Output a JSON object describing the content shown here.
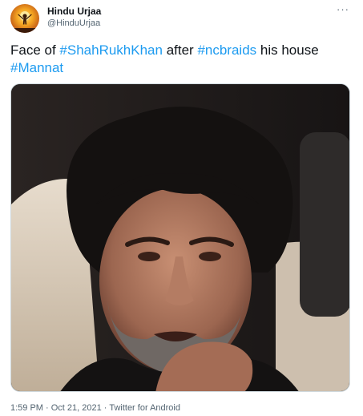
{
  "author": {
    "display_name": "Hindu Urjaa",
    "handle": "@HinduUrjaa"
  },
  "more_icon": "···",
  "tweet_text": {
    "t1": "Face of ",
    "h1": "#ShahRukhKhan",
    "t2": " after ",
    "h2": "#ncbraids",
    "t3": " his house ",
    "h3": "#Mannat"
  },
  "meta": {
    "time": "1:59 PM",
    "sep1": " · ",
    "date": "Oct 21, 2021",
    "sep2": " · ",
    "source": "Twitter for Android"
  },
  "colors": {
    "link": "#1d9bf0",
    "secondary_text": "#536471",
    "primary_text": "#0f1419",
    "border": "#cfd9de"
  },
  "icons": {
    "more": "more-icon",
    "avatar": "avatar"
  }
}
